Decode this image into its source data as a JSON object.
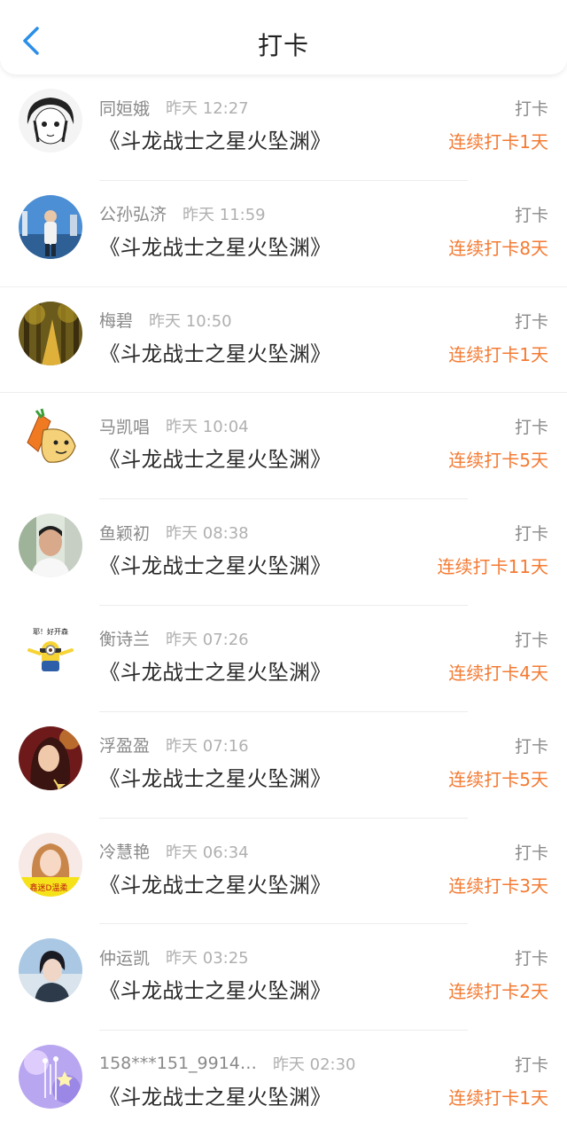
{
  "header": {
    "title": "打卡",
    "back_icon": "chevron-left-icon",
    "accent_color": "#2b8fe8"
  },
  "streak_color": "#f47a32",
  "items": [
    {
      "username": "同姮娥",
      "time": "昨天 12:27",
      "book": "《斗龙战士之星火坠渊》",
      "action": "打卡",
      "streak": "连续打卡1天"
    },
    {
      "username": "公孙弘济",
      "time": "昨天 11:59",
      "book": "《斗龙战士之星火坠渊》",
      "action": "打卡",
      "streak": "连续打卡8天"
    },
    {
      "username": "梅碧",
      "time": "昨天 10:50",
      "book": "《斗龙战士之星火坠渊》",
      "action": "打卡",
      "streak": "连续打卡1天"
    },
    {
      "username": "马凯唱",
      "time": "昨天 10:04",
      "book": "《斗龙战士之星火坠渊》",
      "action": "打卡",
      "streak": "连续打卡5天"
    },
    {
      "username": "鱼颖初",
      "time": "昨天 08:38",
      "book": "《斗龙战士之星火坠渊》",
      "action": "打卡",
      "streak": "连续打卡11天"
    },
    {
      "username": "衡诗兰",
      "time": "昨天 07:26",
      "book": "《斗龙战士之星火坠渊》",
      "action": "打卡",
      "streak": "连续打卡4天",
      "avatar_text": "耶！好开森"
    },
    {
      "username": "浮盈盈",
      "time": "昨天 07:16",
      "book": "《斗龙战士之星火坠渊》",
      "action": "打卡",
      "streak": "连续打卡5天"
    },
    {
      "username": "冷慧艳",
      "time": "昨天 06:34",
      "book": "《斗龙战士之星火坠渊》",
      "action": "打卡",
      "streak": "连续打卡3天",
      "avatar_text": "鑫迷D温柔"
    },
    {
      "username": "仲运凯",
      "time": "昨天 03:25",
      "book": "《斗龙战士之星火坠渊》",
      "action": "打卡",
      "streak": "连续打卡2天"
    },
    {
      "username": "158***151_9914…",
      "time": "昨天 02:30",
      "book": "《斗龙战士之星火坠渊》",
      "action": "打卡",
      "streak": "连续打卡1天"
    }
  ]
}
